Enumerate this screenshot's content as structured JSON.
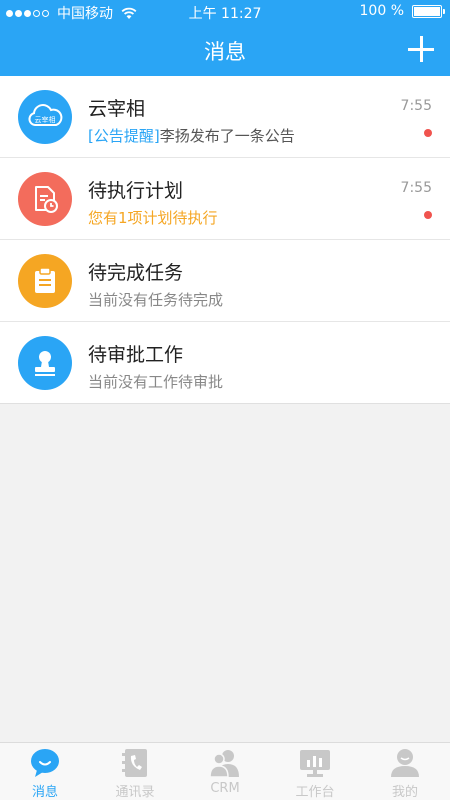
{
  "status_bar": {
    "carrier": "中国移动",
    "time": "上午 11:27",
    "battery": "100 %"
  },
  "header": {
    "title": "消息"
  },
  "messages": [
    {
      "title": "云宰相",
      "time": "7:55",
      "subtitle_tag": "[公告提醒]",
      "subtitle": "李扬发布了一条公告",
      "unread": true,
      "icon": "cloud-logo-icon",
      "icon_text": "云宰相",
      "color": "#2aa5f5"
    },
    {
      "title": "待执行计划",
      "time": "7:55",
      "subtitle": "您有1项计划待执行",
      "subtitle_color": "#f5a623",
      "unread": true,
      "icon": "plan-document-icon",
      "color": "#f36c5c"
    },
    {
      "title": "待完成任务",
      "subtitle": "当前没有任务待完成",
      "icon": "clipboard-icon",
      "color": "#f5a623"
    },
    {
      "title": "待审批工作",
      "subtitle": "当前没有工作待审批",
      "icon": "approval-stamp-icon",
      "color": "#2aa5f5"
    }
  ],
  "tabs": [
    {
      "label": "消息",
      "icon": "chat-bubble-icon",
      "active": true
    },
    {
      "label": "通讯录",
      "icon": "contacts-book-icon"
    },
    {
      "label": "CRM",
      "icon": "crm-people-icon"
    },
    {
      "label": "工作台",
      "icon": "workbench-monitor-icon"
    },
    {
      "label": "我的",
      "icon": "profile-icon"
    }
  ],
  "colors": {
    "accent": "#2aa5f5",
    "unread_dot": "#f0534e",
    "inactive_tab": "#c8c8c8"
  }
}
